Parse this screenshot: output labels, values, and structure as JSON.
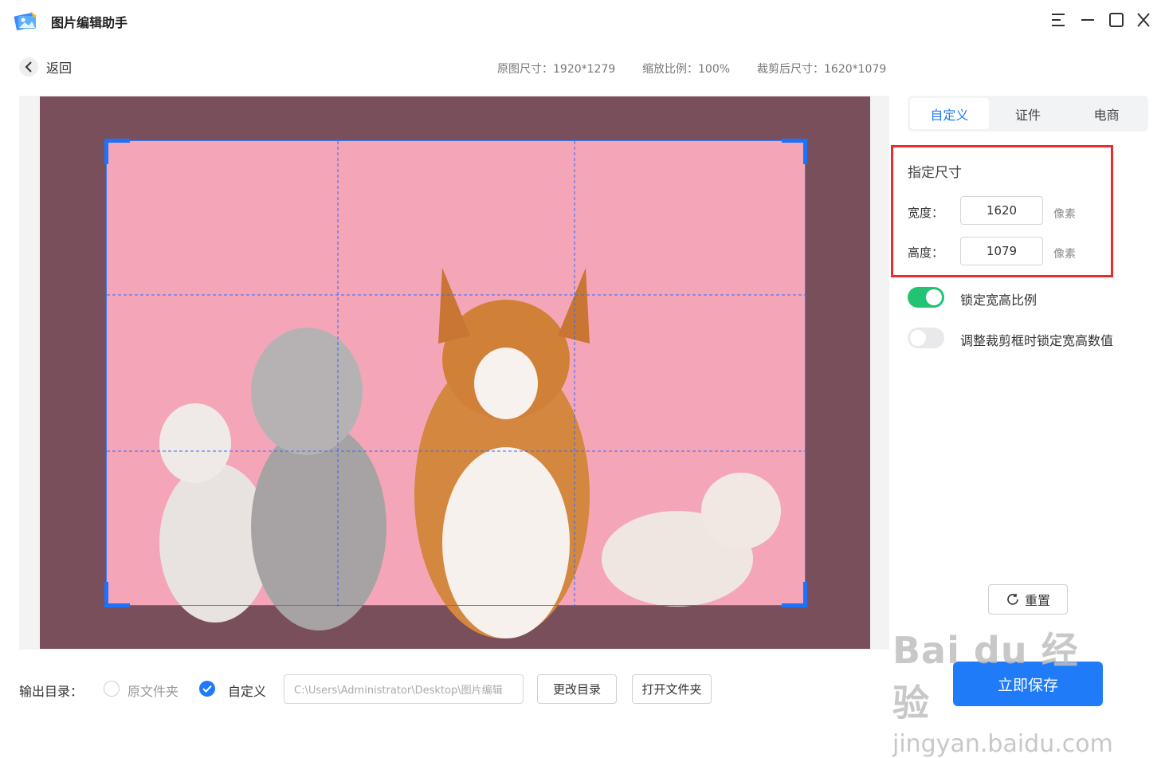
{
  "app": {
    "title": "图片编辑助手"
  },
  "nav": {
    "back_label": "返回"
  },
  "info": {
    "original_size": "原图尺寸：1920*1279",
    "zoom": "缩放比例：100%",
    "cropped_size": "裁剪后尺寸：1620*1079"
  },
  "tabs": [
    {
      "label": "自定义",
      "active": true
    },
    {
      "label": "证件",
      "active": false
    },
    {
      "label": "电商",
      "active": false
    }
  ],
  "size_panel": {
    "title": "指定尺寸",
    "width_label": "宽度：",
    "width_value": "1620",
    "height_label": "高度：",
    "height_value": "1079",
    "unit": "像素"
  },
  "toggles": {
    "lock_ratio": {
      "label": "锁定宽高比例",
      "on": true
    },
    "lock_values": {
      "label": "调整裁剪框时锁定宽高数值",
      "on": false
    }
  },
  "reset_label": "重置",
  "save_label": "立即保存",
  "output": {
    "label": "输出目录：",
    "option_original": "原文件夹",
    "option_custom": "自定义",
    "selected": "自定义",
    "path": "C:\\Users\\Administrator\\Desktop\\图片编辑",
    "change_dir_label": "更改目录",
    "open_folder_label": "打开文件夹"
  },
  "watermark": {
    "line1": "Bai du 经验",
    "line2": "jingyan.baidu.com"
  },
  "colors": {
    "accent": "#1f7bf7",
    "toggle_on": "#22c372",
    "highlight": "#ef2a2a",
    "photo_bg": "#f4a6b8"
  }
}
